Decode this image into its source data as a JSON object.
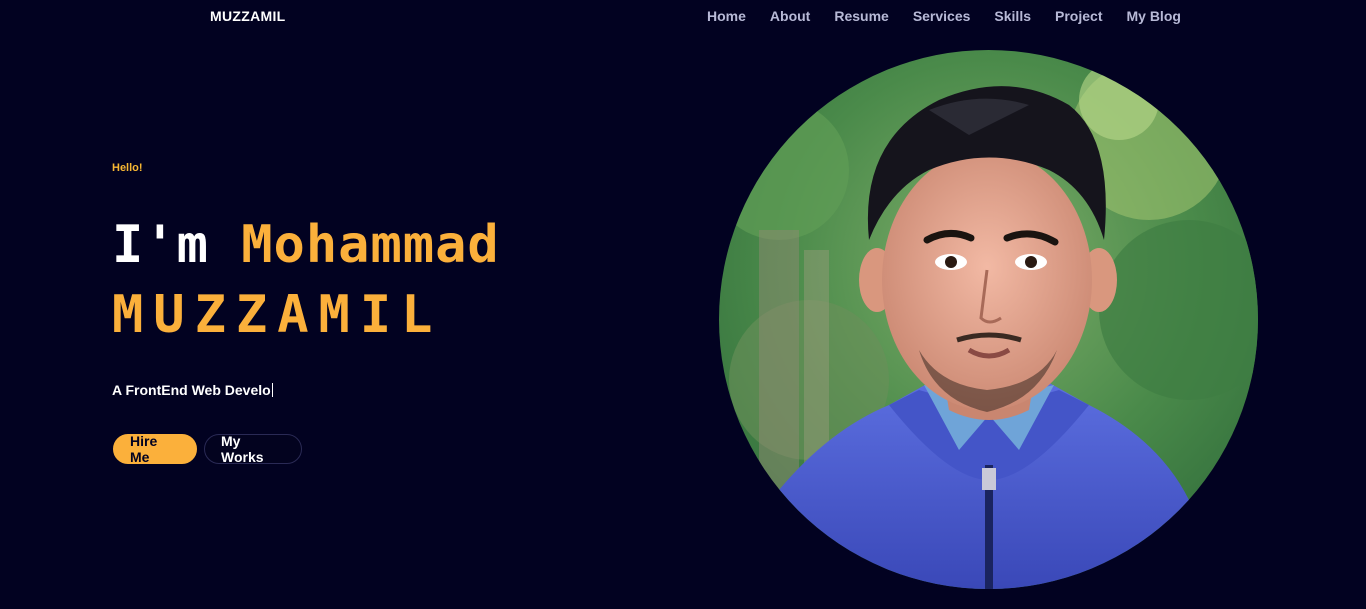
{
  "brand": "MUZZAMIL",
  "nav": {
    "items": [
      "Home",
      "About",
      "Resume",
      "Services",
      "Skills",
      "Project",
      "My Blog"
    ]
  },
  "hero": {
    "greeting": "Hello!",
    "intro": "I'm",
    "first_name": "Mohammad",
    "last_name": "MUZZAMIL",
    "role_text": "A FrontEnd Web Develo",
    "hire_label": "Hire Me",
    "works_label": "My Works"
  },
  "colors": {
    "background": "#020221",
    "accent": "#fbb03b",
    "nav_text": "#b7b9d6"
  }
}
